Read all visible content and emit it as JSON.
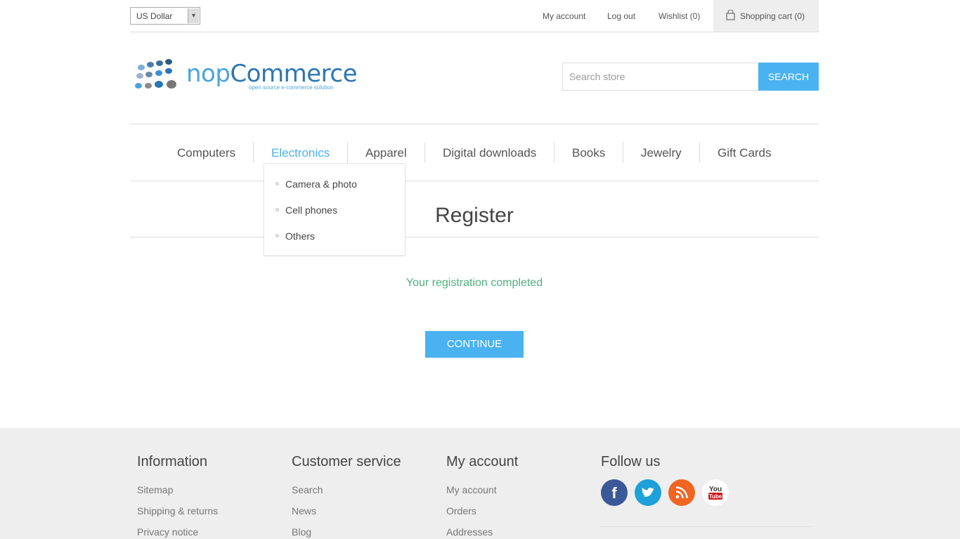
{
  "header": {
    "currency": "US Dollar",
    "links": {
      "my_account": "My account",
      "log_out": "Log out",
      "wishlist": "Wishlist (0)",
      "shopping_cart": "Shopping cart (0)"
    }
  },
  "logo": {
    "name_part1": "nop",
    "name_part2": "Commerce",
    "tagline": "open source e-commerce solution"
  },
  "search": {
    "placeholder": "Search store",
    "button": "SEARCH"
  },
  "menu": {
    "items": [
      "Computers",
      "Electronics",
      "Apparel",
      "Digital downloads",
      "Books",
      "Jewelry",
      "Gift Cards"
    ],
    "active": "Electronics",
    "dropdown": [
      "Camera & photo",
      "Cell phones",
      "Others"
    ]
  },
  "page": {
    "title": "Register",
    "result": "Your registration completed",
    "continue": "CONTINUE"
  },
  "footer": {
    "information": {
      "title": "Information",
      "links": [
        "Sitemap",
        "Shipping & returns",
        "Privacy notice"
      ]
    },
    "customer_service": {
      "title": "Customer service",
      "links": [
        "Search",
        "News",
        "Blog"
      ]
    },
    "my_account": {
      "title": "My account",
      "links": [
        "My account",
        "Orders",
        "Addresses"
      ]
    },
    "follow_us": {
      "title": "Follow us",
      "icons": [
        "facebook-icon",
        "twitter-icon",
        "rss-icon",
        "youtube-icon"
      ],
      "youtube_you": "You",
      "youtube_tube": "Tube"
    }
  },
  "colors": {
    "accent": "#4ab2f1",
    "success": "#4cb17c",
    "facebook": "#3b5998",
    "twitter": "#1da1d8",
    "rss": "#f06522",
    "youtube": "#cc181e"
  }
}
